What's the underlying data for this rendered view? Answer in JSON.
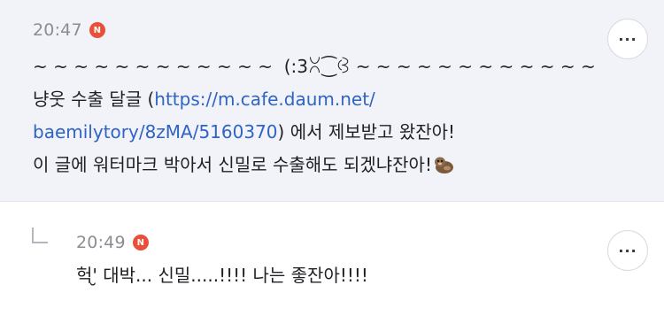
{
  "post": {
    "time": "20:47",
    "badge": "N",
    "more_label": "...",
    "line1": "~ ~ ~ ~ ~ ~ ~ ~ ~ ~ ~ ~  (:3ꇤ⁐ꃳ ~ ~ ~ ~ ~ ~ ~ ~ ~ ~ ~ ~",
    "line2_prefix": "냥웃 수출 달글 (",
    "link_part1": "https://m.cafe.daum.net/",
    "link_part2": "baemilytory/8zMA/5160370",
    "line3_suffix": ") 에서 제보받고 왔잔아!",
    "line4": "이 글에 워터마크 박아서 신밀로 수출해도 되겠냐잔아!",
    "emoji_icon": "otter-icon"
  },
  "reply": {
    "time": "20:49",
    "badge": "N",
    "more_label": "...",
    "text": "헉'̮ 대박... 신밀.....!!!! 나는 좋잔아!!!!"
  },
  "colors": {
    "post_background": "#f1f3f9",
    "link": "#2f63c4",
    "badge": "#ea4f3a"
  }
}
